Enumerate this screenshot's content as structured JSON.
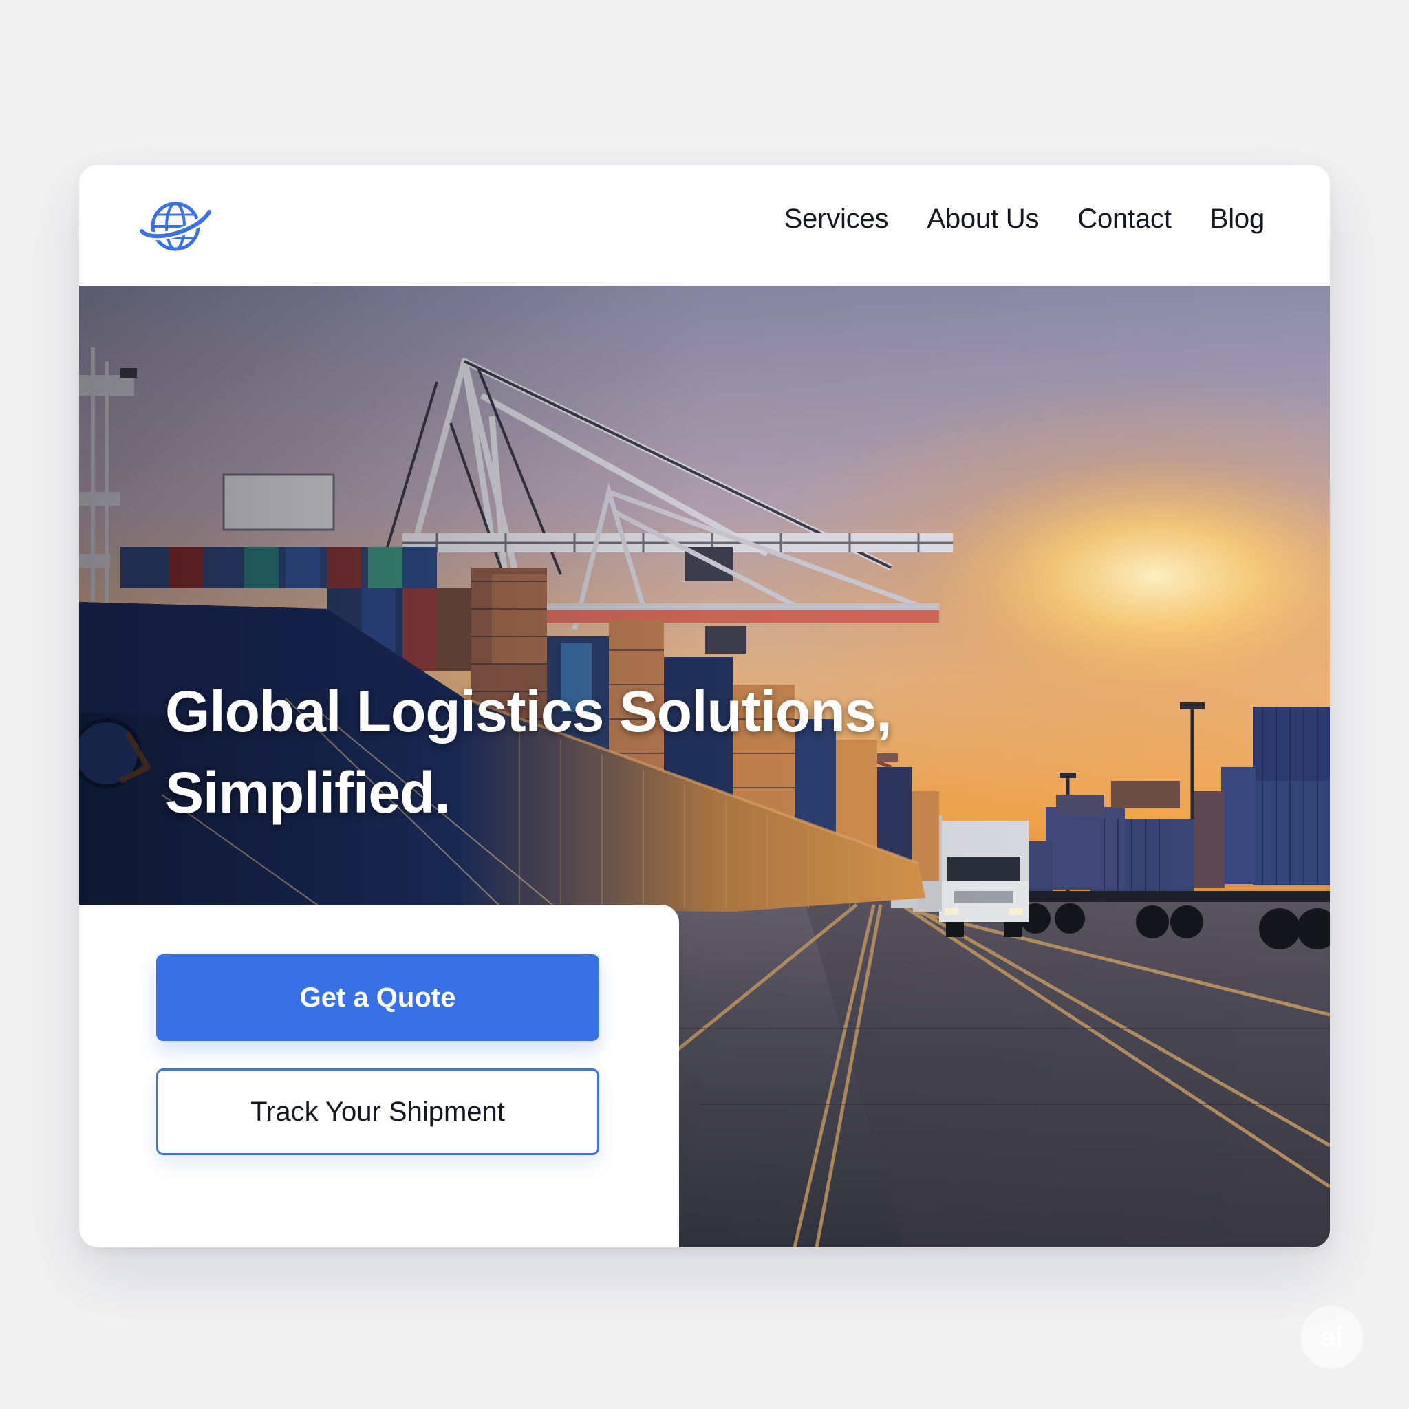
{
  "header": {
    "logo_icon": "globe-orbit-icon",
    "nav": [
      {
        "label": "Services"
      },
      {
        "label": "About Us"
      },
      {
        "label": "Contact"
      },
      {
        "label": "Blog"
      }
    ]
  },
  "hero": {
    "headline_line1": "Global Logistics Solutions,",
    "headline_line2": "Simplified.",
    "image": "container-port-sunset-photo"
  },
  "cta": {
    "primary_label": "Get a Quote",
    "secondary_label": "Track Your Shipment"
  },
  "watermark": {
    "text": "ai"
  },
  "colors": {
    "accent": "#3871e6",
    "background": "#f1f1f2",
    "card": "#ffffff",
    "nav_text": "#141820"
  }
}
